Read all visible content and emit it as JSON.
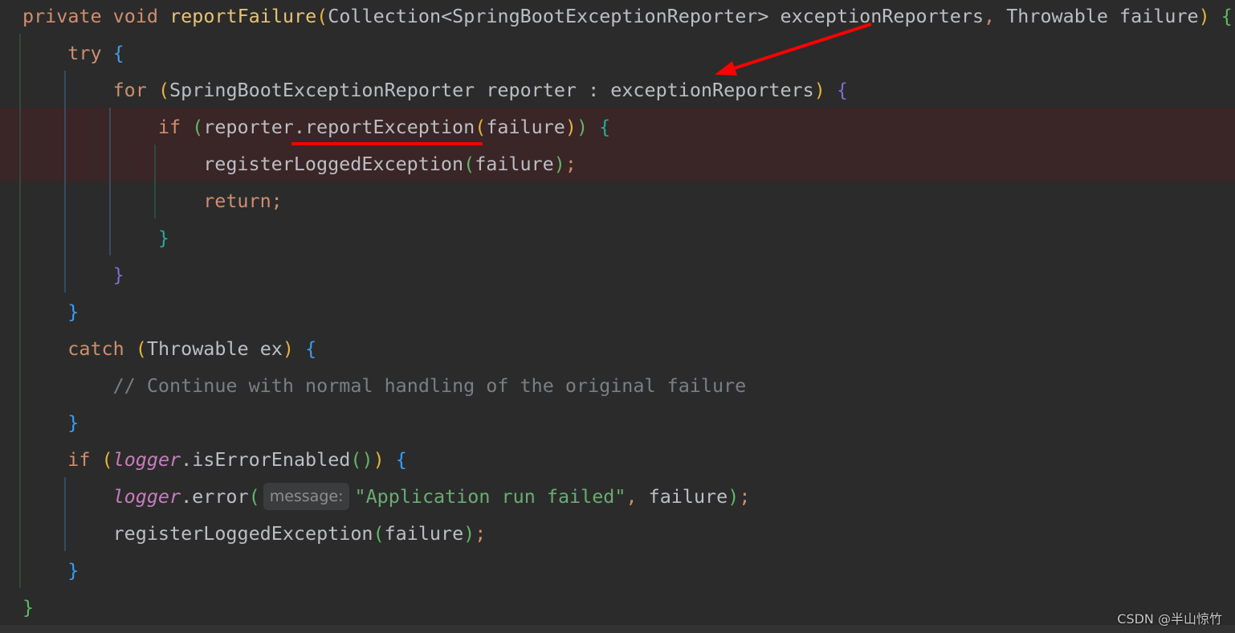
{
  "editor": {
    "highlight_color": "#3a2527",
    "annotation_color": "#ff0000",
    "lines": [
      {
        "indent": 0,
        "tokens": [
          [
            "private void ",
            "kw"
          ],
          [
            "reportFailure",
            "fn"
          ],
          [
            "(",
            "p1"
          ],
          [
            "Collection<SpringBootExceptionReporter> exceptionReporters",
            "tx"
          ],
          [
            ", ",
            "kw"
          ],
          [
            "Throwable failure",
            "tx"
          ],
          [
            ")",
            "p1"
          ],
          [
            " ",
            "tx"
          ],
          [
            "{",
            "b1"
          ]
        ]
      },
      {
        "indent": 1,
        "tokens": [
          [
            "try ",
            "kw"
          ],
          [
            "{",
            "b2"
          ]
        ]
      },
      {
        "indent": 2,
        "tokens": [
          [
            "for ",
            "kw"
          ],
          [
            "(",
            "p1"
          ],
          [
            "SpringBootExceptionReporter reporter : exceptionReporters",
            "tx"
          ],
          [
            ")",
            "p1"
          ],
          [
            " ",
            "tx"
          ],
          [
            "{",
            "b3"
          ]
        ]
      },
      {
        "indent": 3,
        "tokens": [
          [
            "if ",
            "kw"
          ],
          [
            "(",
            "p2"
          ],
          [
            "reporter.reportException",
            "tx"
          ],
          [
            "(",
            "p1"
          ],
          [
            "failure",
            "tx"
          ],
          [
            ")",
            "p1"
          ],
          [
            ")",
            "p2"
          ],
          [
            " ",
            "tx"
          ],
          [
            "{",
            "b4"
          ]
        ]
      },
      {
        "indent": 4,
        "tokens": [
          [
            "registerLoggedException",
            "tx"
          ],
          [
            "(",
            "p2"
          ],
          [
            "failure",
            "tx"
          ],
          [
            ")",
            "p2"
          ],
          [
            ";",
            "kw"
          ]
        ]
      },
      {
        "indent": 4,
        "tokens": [
          [
            "return;",
            "kw"
          ]
        ]
      },
      {
        "indent": 3,
        "tokens": [
          [
            "}",
            "b4"
          ]
        ]
      },
      {
        "indent": 2,
        "tokens": [
          [
            "}",
            "b3"
          ]
        ]
      },
      {
        "indent": 1,
        "tokens": [
          [
            "}",
            "b2"
          ]
        ]
      },
      {
        "indent": 1,
        "tokens": [
          [
            "catch ",
            "kw"
          ],
          [
            "(",
            "p1"
          ],
          [
            "Throwable ex",
            "tx"
          ],
          [
            ")",
            "p1"
          ],
          [
            " ",
            "tx"
          ],
          [
            "{",
            "b2"
          ]
        ]
      },
      {
        "indent": 2,
        "tokens": [
          [
            "// Continue with normal handling of the original failure",
            "cm"
          ]
        ]
      },
      {
        "indent": 1,
        "tokens": [
          [
            "}",
            "b2"
          ]
        ]
      },
      {
        "indent": 1,
        "tokens": [
          [
            "if ",
            "kw"
          ],
          [
            "(",
            "p1"
          ],
          [
            "logger",
            "fld"
          ],
          [
            ".isErrorEnabled",
            "tx"
          ],
          [
            "()",
            "p2"
          ],
          [
            ")",
            "p1"
          ],
          [
            " ",
            "tx"
          ],
          [
            "{",
            "b2"
          ]
        ]
      },
      {
        "indent": 2,
        "tokens": [
          [
            "logger",
            "fld"
          ],
          [
            ".error",
            "tx"
          ],
          [
            "(",
            "p2"
          ],
          [
            "message:",
            "hint"
          ],
          [
            "\"Application run failed\"",
            "st"
          ],
          [
            ", ",
            "kw"
          ],
          [
            "failure",
            "tx"
          ],
          [
            ")",
            "p2"
          ],
          [
            ";",
            "kw"
          ]
        ]
      },
      {
        "indent": 2,
        "tokens": [
          [
            "registerLoggedException",
            "tx"
          ],
          [
            "(",
            "p2"
          ],
          [
            "failure",
            "tx"
          ],
          [
            ")",
            "p2"
          ],
          [
            ";",
            "kw"
          ]
        ]
      },
      {
        "indent": 1,
        "tokens": [
          [
            "}",
            "b2"
          ]
        ]
      },
      {
        "indent": 0,
        "tokens": [
          [
            "}",
            "b1"
          ]
        ]
      }
    ]
  },
  "watermark": "CSDN @半山惊竹"
}
